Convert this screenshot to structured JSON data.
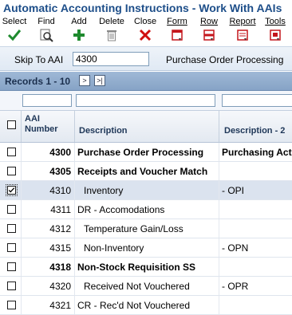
{
  "window": {
    "title": "Automatic Accounting Instructions - Work With AAIs"
  },
  "toolbar": {
    "items": [
      {
        "label": "Select",
        "icon": "check-icon",
        "color": "#1e8a2e"
      },
      {
        "label": "Find",
        "icon": "find-icon",
        "color": "#555555"
      },
      {
        "label": "Add",
        "icon": "plus-icon",
        "color": "#1e8a2e"
      },
      {
        "label": "Delete",
        "icon": "trash-icon",
        "color": "#777777"
      },
      {
        "label": "Close",
        "icon": "close-x-icon",
        "color": "#d01010"
      },
      {
        "label": "Form",
        "icon": "form-icon",
        "color": "#c4161c"
      },
      {
        "label": "Row",
        "icon": "row-icon",
        "color": "#c4161c"
      },
      {
        "label": "Report",
        "icon": "report-icon",
        "color": "#c4161c"
      },
      {
        "label": "Tools",
        "icon": "tools-icon",
        "color": "#c4161c"
      }
    ]
  },
  "skip": {
    "label": "Skip To AAI",
    "value": "4300",
    "description": "Purchase Order Processing"
  },
  "records": {
    "label": "Records 1 - 10",
    "nav_first_symbol": ">",
    "nav_last_symbol": ">|"
  },
  "grid": {
    "columns": [
      {
        "label_line1": "AAI",
        "label_line2": "Number"
      },
      {
        "label": "Description"
      },
      {
        "label": "Description - 2"
      }
    ],
    "rows": [
      {
        "number": "4300",
        "description": "Purchase Order Processing",
        "description2": "Purchasing Act",
        "bold": true,
        "selected": false
      },
      {
        "number": "4305",
        "description": "Receipts and Voucher Match",
        "description2": "",
        "bold": true,
        "selected": false
      },
      {
        "number": "4310",
        "description": "Inventory",
        "description2": "- OPI",
        "bold": false,
        "indent": true,
        "selected": true
      },
      {
        "number": "4311",
        "description": "DR - Accomodations",
        "description2": "",
        "bold": false,
        "selected": false
      },
      {
        "number": "4312",
        "description": "Temperature Gain/Loss",
        "description2": "",
        "bold": false,
        "indent": true,
        "selected": false
      },
      {
        "number": "4315",
        "description": "Non-Inventory",
        "description2": "- OPN",
        "bold": false,
        "indent": true,
        "selected": false
      },
      {
        "number": "4318",
        "description": "Non-Stock Requisition SS",
        "description2": "",
        "bold": true,
        "selected": false
      },
      {
        "number": "4320",
        "description": "Received Not Vouchered",
        "description2": "- OPR",
        "bold": false,
        "indent": true,
        "selected": false
      },
      {
        "number": "4321",
        "description": "CR - Rec'd Not Vouchered",
        "description2": "",
        "bold": false,
        "selected": false
      }
    ]
  }
}
